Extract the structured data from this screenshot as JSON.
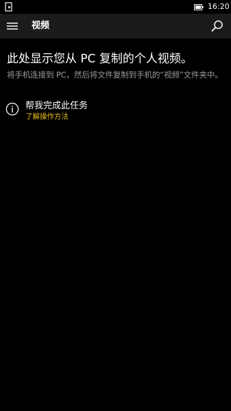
{
  "status_bar": {
    "time": "16:20",
    "left_icon": "notification-icon",
    "battery_icon": "battery-icon"
  },
  "header": {
    "title": "视频",
    "menu_icon": "hamburger-menu-icon",
    "search_icon": "search-icon"
  },
  "main": {
    "heading": "此处显示您从 PC 复制的个人视频。",
    "description": "将手机连接到 PC，然后将文件复制到手机的“视频”文件夹中。"
  },
  "help": {
    "icon": "info-icon",
    "title": "帮我完成此任务",
    "link": "了解操作方法"
  },
  "colors": {
    "background": "#000000",
    "header_background": "#1b1b1b",
    "text_primary": "#ffffff",
    "text_secondary": "#9a9a9a",
    "accent": "#e8b921"
  }
}
